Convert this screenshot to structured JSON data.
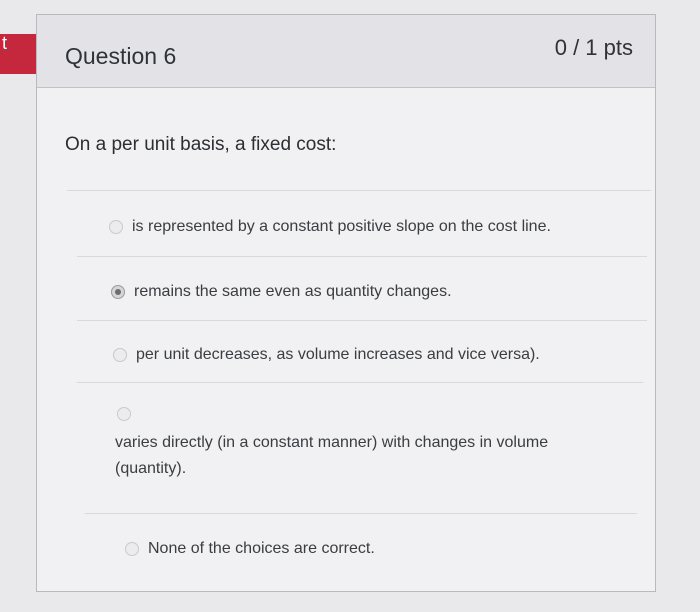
{
  "left_tab": {
    "text": "t"
  },
  "question": {
    "title": "Question 6",
    "points": "0 / 1 pts",
    "prompt": "On a per unit basis, a fixed cost:",
    "answers": [
      {
        "text": "is represented by a constant positive slope on the cost line.",
        "selected": false
      },
      {
        "text": "remains the same even as quantity changes.",
        "selected": true
      },
      {
        "text": "per unit decreases, as volume increases and vice versa).",
        "selected": false
      },
      {
        "text_line1": "varies directly (in a constant manner) with changes in volume",
        "text_line2": "(quantity).",
        "selected": false
      },
      {
        "text": "None of the choices are correct.",
        "selected": false
      }
    ]
  },
  "colors": {
    "accent": "#c5283d",
    "page_bg": "#e9e8ea",
    "card_bg": "#f1f0f2",
    "header_bg": "#e3e2e6"
  }
}
